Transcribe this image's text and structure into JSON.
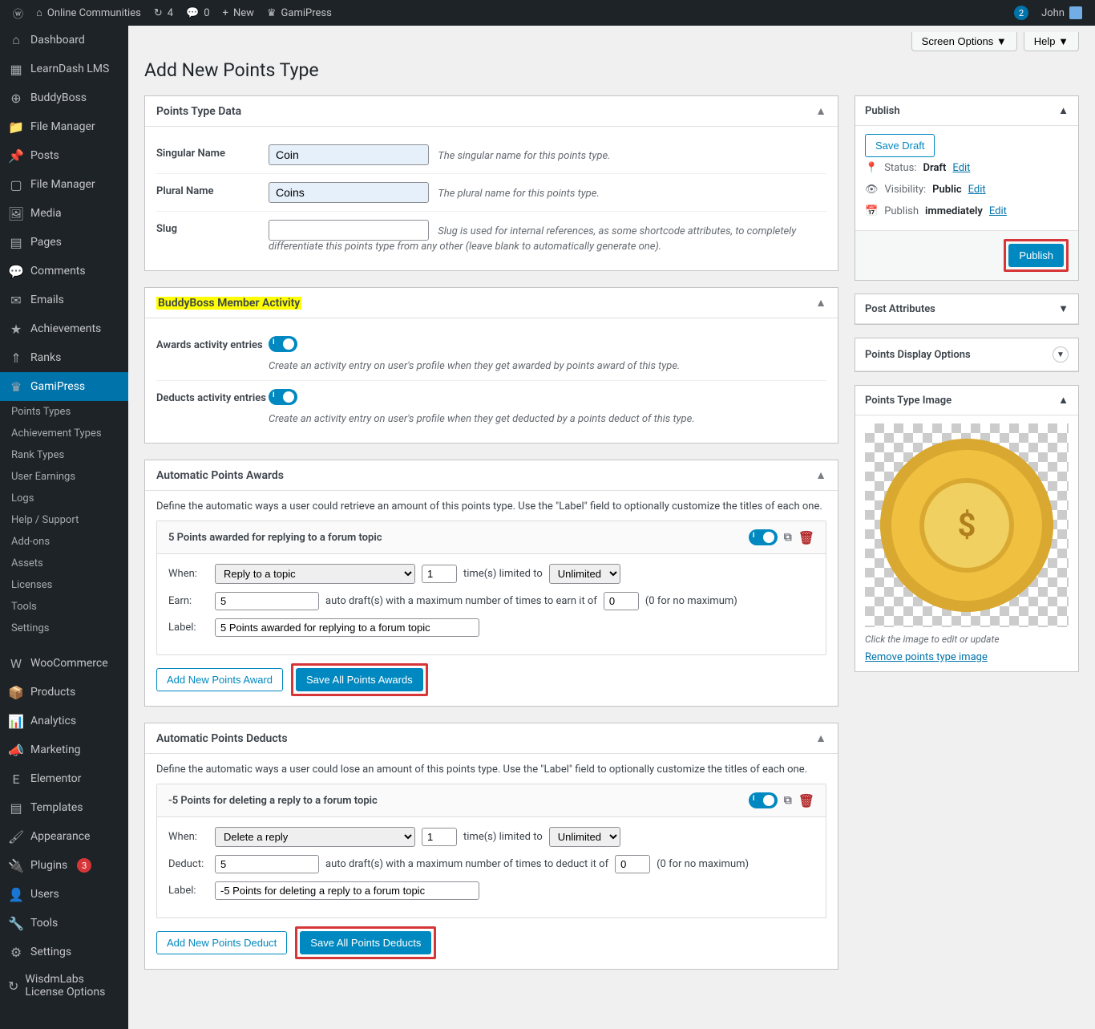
{
  "adminbar": {
    "site_name": "Online Communities",
    "updates": "4",
    "comments": "0",
    "new": "New",
    "gamipress": "GamiPress",
    "notif_count": "2",
    "user": "John"
  },
  "sidebar": {
    "items": [
      {
        "label": "Dashboard",
        "icon": "⌂"
      },
      {
        "label": "LearnDash LMS",
        "icon": "▦"
      },
      {
        "label": "BuddyBoss",
        "icon": "⊕"
      },
      {
        "label": "File Manager",
        "icon": "📁"
      },
      {
        "label": "Posts",
        "icon": "📌"
      },
      {
        "label": "File Manager",
        "icon": "▢"
      },
      {
        "label": "Media",
        "icon": "🖼"
      },
      {
        "label": "Pages",
        "icon": "▤"
      },
      {
        "label": "Comments",
        "icon": "💬"
      },
      {
        "label": "Emails",
        "icon": "✉"
      },
      {
        "label": "Achievements",
        "icon": "★"
      },
      {
        "label": "Ranks",
        "icon": "⇑"
      },
      {
        "label": "GamiPress",
        "icon": "♛",
        "active": true
      }
    ],
    "sub_items": [
      "Points Types",
      "Achievement Types",
      "Rank Types",
      "User Earnings",
      "Logs",
      "Help / Support",
      "Add-ons",
      "Assets",
      "Licenses",
      "Tools",
      "Settings"
    ],
    "items2": [
      {
        "label": "WooCommerce",
        "icon": "W"
      },
      {
        "label": "Products",
        "icon": "📦"
      },
      {
        "label": "Analytics",
        "icon": "📊"
      },
      {
        "label": "Marketing",
        "icon": "📣"
      },
      {
        "label": "Elementor",
        "icon": "E"
      },
      {
        "label": "Templates",
        "icon": "▤"
      },
      {
        "label": "Appearance",
        "icon": "🖌"
      },
      {
        "label": "Plugins",
        "icon": "🔌",
        "badge": "3"
      },
      {
        "label": "Users",
        "icon": "👤"
      },
      {
        "label": "Tools",
        "icon": "🔧"
      },
      {
        "label": "Settings",
        "icon": "⚙"
      },
      {
        "label": "WisdmLabs License Options",
        "icon": "↻"
      }
    ]
  },
  "top": {
    "screen_options": "Screen Options",
    "help": "Help"
  },
  "page_title": "Add New Points Type",
  "points_data": {
    "title": "Points Type Data",
    "singular": {
      "label": "Singular Name",
      "value": "Coin",
      "hint": "The singular name for this points type."
    },
    "plural": {
      "label": "Plural Name",
      "value": "Coins",
      "hint": "The plural name for this points type."
    },
    "slug": {
      "label": "Slug",
      "value": "",
      "hint": "Slug is used for internal references, as some shortcode attributes, to completely differentiate this points type from any other (leave blank to automatically generate one)."
    }
  },
  "bb_activity": {
    "title": "BuddyBoss Member Activity",
    "awards": {
      "label": "Awards activity entries",
      "desc": "Create an activity entry on user's profile when they get awarded by points award of this type."
    },
    "deducts": {
      "label": "Deducts activity entries",
      "desc": "Create an activity entry on user's profile when they get deducted by a points deduct of this type."
    }
  },
  "auto_awards": {
    "title": "Automatic Points Awards",
    "desc": "Define the automatic ways a user could retrieve an amount of this points type. Use the \"Label\" field to optionally customize the titles of each one.",
    "item_title": "5 Points awarded for replying to a forum topic",
    "when": "When:",
    "when_val": "Reply to a topic",
    "times_val": "1",
    "times_txt": "time(s) limited to",
    "times_limit": "Unlimited",
    "earn": "Earn:",
    "earn_val": "5",
    "earn_txt": "auto draft(s) with a maximum number of times to earn it of",
    "earn_max": "0",
    "earn_max_txt": "(0 for no maximum)",
    "label": "Label:",
    "label_val": "5 Points awarded for replying to a forum topic",
    "add_btn": "Add New Points Award",
    "save_btn": "Save All Points Awards"
  },
  "auto_deducts": {
    "title": "Automatic Points Deducts",
    "desc": "Define the automatic ways a user could lose an amount of this points type. Use the \"Label\" field to optionally customize the titles of each one.",
    "item_title": "-5 Points for deleting a reply to a forum topic",
    "when": "When:",
    "when_val": "Delete a reply",
    "times_val": "1",
    "times_txt": "time(s) limited to",
    "times_limit": "Unlimited",
    "deduct": "Deduct:",
    "deduct_val": "5",
    "deduct_txt": "auto draft(s) with a maximum number of times to deduct it of",
    "deduct_max": "0",
    "deduct_max_txt": "(0 for no maximum)",
    "label": "Label:",
    "label_val": "-5 Points for deleting a reply to a forum topic",
    "add_btn": "Add New Points Deduct",
    "save_btn": "Save All Points Deducts"
  },
  "publish": {
    "title": "Publish",
    "save_draft": "Save Draft",
    "status": "Status:",
    "status_val": "Draft",
    "edit": "Edit",
    "visibility": "Visibility:",
    "visibility_val": "Public",
    "publish": "Publish",
    "publish_val": "immediately",
    "publish_btn": "Publish"
  },
  "attrs": {
    "title": "Post Attributes"
  },
  "disp_opts": {
    "title": "Points Display Options"
  },
  "img": {
    "title": "Points Type Image",
    "caption": "Click the image to edit or update",
    "remove": "Remove points type image"
  }
}
